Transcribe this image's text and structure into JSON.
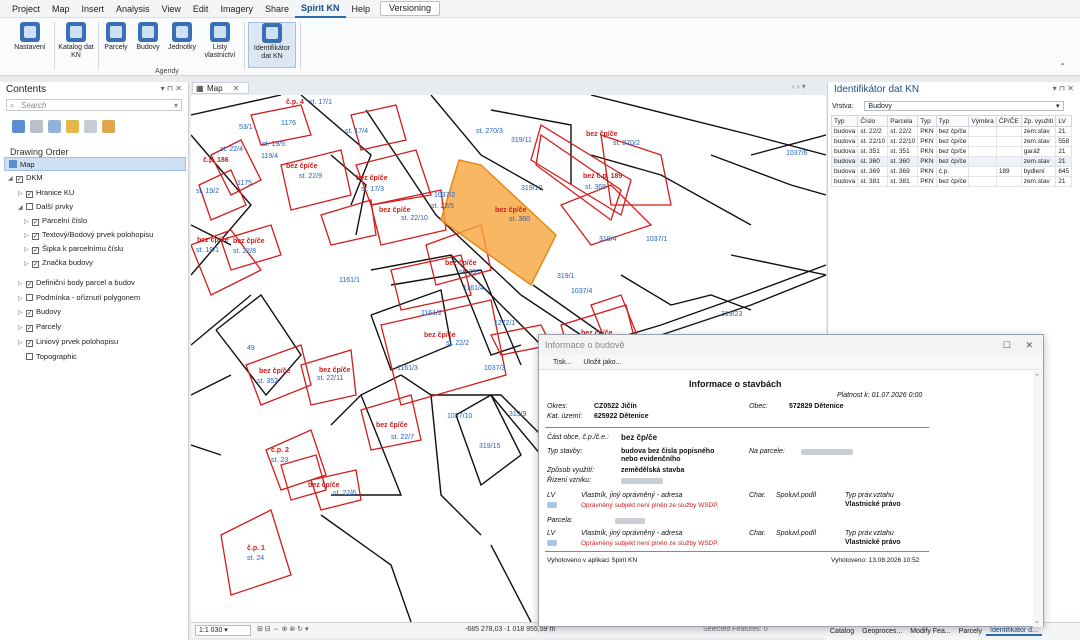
{
  "menu": {
    "items": [
      "Project",
      "Map",
      "Insert",
      "Analysis",
      "View",
      "Edit",
      "Imagery",
      "Share",
      "Spirit KN",
      "Help"
    ],
    "active": "Spirit KN",
    "versioning": "Versioning"
  },
  "ribbon": {
    "buttons": {
      "nastaveni": "Nastavení",
      "katalog": "Katalog dat KN",
      "parcely": "Parcely",
      "budovy": "Budovy",
      "jednotky": "Jednotky",
      "listy": "Listy vlastnictví",
      "identifikator": "Identifikátor dat KN"
    },
    "group_label": "Agendy"
  },
  "contents": {
    "title": "Contents",
    "search_placeholder": "Search",
    "drawing_order": "Drawing Order",
    "tree": [
      "Map",
      "DKM",
      "Hranice KU",
      "Další prvky",
      "Parcelní číslo",
      "Textový/Bodový prvek polohopisu",
      "Šipka k parcelnímu číslu",
      "Značka budovy",
      "Definiční body parcel a budov",
      "Podmínka - oříznutí polygonem",
      "Budovy",
      "Parcely",
      "Liniový prvek polohopisu",
      "Topographic"
    ]
  },
  "map": {
    "tab": "Map",
    "labels": {
      "l1": "č.p. 4",
      "l2": "st. 17/1",
      "l3": "319/11",
      "l4": "st. 270/3",
      "l5": "bez čp/če",
      "l6": "st. 270/2",
      "l7": "1037/6",
      "l8": "bez čp/če",
      "l9": "st. 22/9",
      "l10": "bez čp/če",
      "l11": "st. 17/3",
      "l12": "bez čp/če",
      "l13": "st. 22/10",
      "l14": "1037/2",
      "l15": "st. 22/5",
      "l16": "319/10",
      "l17": "bez čp/če",
      "l18": "st. 360",
      "l19": "bez č.p. 189",
      "l20": "st. 369",
      "l21": "bez čp/če",
      "l22": "st. 19/1",
      "l23": "bez čp/če",
      "l24": "st. 22/8",
      "l25": "319/4",
      "l26": "1037/1",
      "l27": "bez čp/če",
      "l28": "st. 351",
      "l29": "1161/1",
      "l30": "1161/4",
      "l31": "319/1",
      "l32": "1037/4",
      "l33": "1161/2",
      "l34": "bez čp/če",
      "l35": "st. 22/2",
      "l36": "1272/1",
      "l37": "319/23",
      "l38": "bez čp/če",
      "l39": "49",
      "l40": "bez čp/če",
      "l41": "st. 352",
      "l42": "bez čp/če",
      "l43": "st. 22/11",
      "l44": "1161/3",
      "l45": "1037/3",
      "l46": "319/9",
      "l47": "bez čp/če",
      "l48": "st. 22/7",
      "l49": "1037/10",
      "l50": "319/15",
      "l51": "č.p. 2",
      "l52": "st. 23",
      "l53": "bez čp/če",
      "l54": "st. 22/6",
      "l55": "č.p. 1",
      "l56": "st. 24",
      "l57": "53/1",
      "l58": "1176",
      "l59": "st. 22/4",
      "l60": "119/4",
      "l61": "st. 19/5",
      "l62": "č.p. 186",
      "l63": "st. 17/4",
      "l64": "st. 19/2",
      "l65": "1175"
    },
    "scale": "1:1 030",
    "coords": "-685 278,03 -1 018 955,59 m",
    "selected_features": "Selected Features: 0"
  },
  "identifier": {
    "title": "Identifikátor dat KN",
    "layer_label": "Vrstva:",
    "layer_value": "Budovy",
    "columns": [
      "Typ",
      "Číslo",
      "Parcela",
      "Typ",
      "Typ",
      "Výměra",
      "ČP/ČE",
      "Zp. využití",
      "LV"
    ],
    "rows": [
      [
        "budova",
        "st. 22/2",
        "st. 22/2",
        "PKN",
        "bez čp/če",
        "",
        "",
        "zem.stav",
        "21"
      ],
      [
        "budova",
        "st. 22/10",
        "st. 22/10",
        "PKN",
        "bez čp/če",
        "",
        "",
        "zem.stav",
        "558"
      ],
      [
        "budova",
        "st. 351",
        "st. 351",
        "PKN",
        "bez čp/če",
        "",
        "",
        "garáž",
        "21"
      ],
      [
        "budova",
        "st. 360",
        "st. 360",
        "PKN",
        "bez čp/če",
        "",
        "",
        "zem.stav",
        "21"
      ],
      [
        "budova",
        "st. 369",
        "st. 369",
        "PKN",
        "č.p.",
        "",
        "189",
        "bydlení",
        "645"
      ],
      [
        "budova",
        "st. 381",
        "st. 381",
        "PKN",
        "bez čp/če",
        "",
        "",
        "zem.stav",
        "21"
      ]
    ]
  },
  "bottom_tabs": [
    "Catalog",
    "Geoproces...",
    "Modify Fea...",
    "Parcely",
    "Identifikátor d..."
  ],
  "dialog": {
    "title": "Informace o budově",
    "toolbar": [
      "Tisk...",
      "Uložit jako..."
    ],
    "heading": "Informace o stavbách",
    "platnost": "Platnost k: 01.07.2026 0:00",
    "okres_label": "Okres:",
    "okres_value": "CZ0522 Jičín",
    "obec_label": "Obec:",
    "obec_value": "572829 Dětenice",
    "ku_label": "Kat. území:",
    "ku_value": "625922 Dětenice",
    "cast_obce_label": "Část obce, č.p./č.e.:",
    "cast_obce_value": "bez čp/če",
    "typ_stavby_label": "Typ stavby:",
    "typ_stavby_value": "budova bez čísla popisného nebo evidenčního",
    "na_parcele_label": "Na parcele:",
    "zpusob_label": "Způsob využití:",
    "zpusob_value": "zemědělská stavba",
    "rizeni_label": "Řízení vzniku:",
    "lv_label": "LV",
    "vlastnik_label": "Vlastník, jiný oprávněný - adresa",
    "char_label": "Char.",
    "spoluvl_label": "Spoluvl.podíl",
    "typ_prav_label": "Typ práv.vztahu",
    "typ_prav_value": "Vlastnické právo",
    "opravneny_note": "Oprávněný subjekt není plněn ze služby WSDP.",
    "parcela_label": "Parcela:",
    "vyhotoveno_app": "Vyhotoveno v aplikaci Spirit KN",
    "vyhotoveno_date": "Vyhotoveno: 13.08.2026 10:52"
  }
}
